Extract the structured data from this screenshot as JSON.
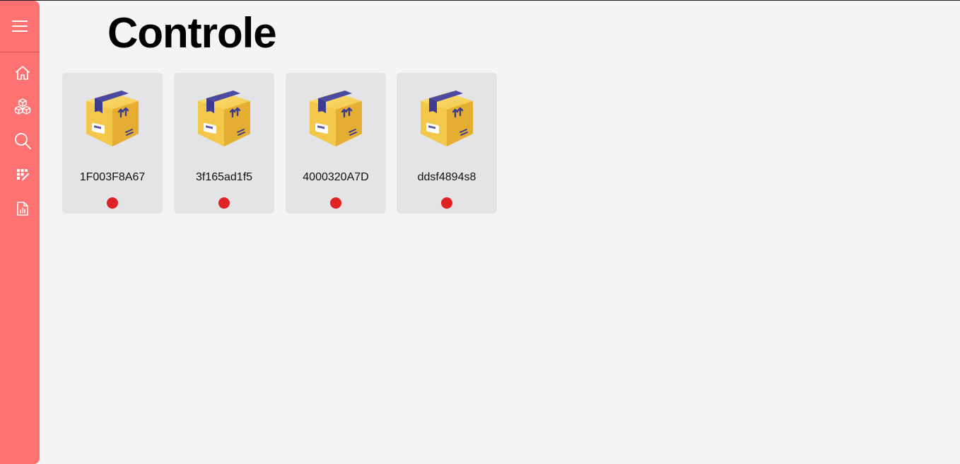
{
  "page": {
    "title": "Controle"
  },
  "sidebar": {
    "background": "#fe7271",
    "items": [
      {
        "icon": "menu-icon"
      },
      {
        "icon": "home-icon"
      },
      {
        "icon": "boxes-icon"
      },
      {
        "icon": "search-icon"
      },
      {
        "icon": "grid-edit-icon"
      },
      {
        "icon": "report-icon"
      }
    ]
  },
  "devices": [
    {
      "id": "1F003F8A67",
      "icon": "package-icon",
      "status_color": "#df2325"
    },
    {
      "id": "3f165ad1f5",
      "icon": "package-icon",
      "status_color": "#df2325"
    },
    {
      "id": "4000320A7D",
      "icon": "package-icon",
      "status_color": "#df2325"
    },
    {
      "id": "ddsf4894s8",
      "icon": "package-icon",
      "status_color": "#df2325"
    }
  ]
}
